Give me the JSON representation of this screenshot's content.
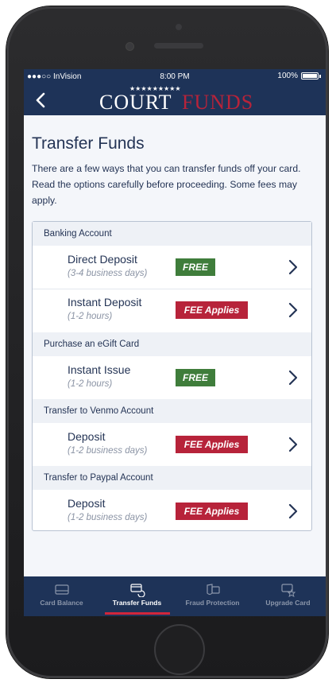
{
  "status_bar": {
    "carrier": "●●●○○ InVision",
    "time": "8:00 PM",
    "battery": "100%"
  },
  "header": {
    "back_icon": "back-chevron-icon",
    "logo_left": "COURT",
    "logo_right": "FUNDS"
  },
  "page": {
    "title": "Transfer Funds",
    "intro": "There are a few ways that you can transfer funds off your card. Read the options carefully before proceeding. Some fees may apply."
  },
  "sections": [
    {
      "header": "Banking Account",
      "options": [
        {
          "name": "Direct Deposit",
          "time": "(3-4 business days)",
          "badge": "FREE",
          "badge_type": "free"
        },
        {
          "name": "Instant Deposit",
          "time": "(1-2 hours)",
          "badge": "FEE Applies",
          "badge_type": "fee"
        }
      ]
    },
    {
      "header": "Purchase an eGift Card",
      "options": [
        {
          "name": "Instant Issue",
          "time": "(1-2 hours)",
          "badge": "FREE",
          "badge_type": "free"
        }
      ]
    },
    {
      "header": "Transfer to Venmo Account",
      "options": [
        {
          "name": "Deposit",
          "time": "(1-2 business days)",
          "badge": "FEE Applies",
          "badge_type": "fee"
        }
      ]
    },
    {
      "header": "Transfer to Paypal Account",
      "options": [
        {
          "name": "Deposit",
          "time": "(1-2 business days)",
          "badge": "FEE Applies",
          "badge_type": "fee"
        }
      ]
    }
  ],
  "tabs": [
    {
      "label": "Card Balance",
      "icon": "card-icon",
      "active": false
    },
    {
      "label": "Transfer Funds",
      "icon": "transfer-card-icon",
      "active": true
    },
    {
      "label": "Fraud Protection",
      "icon": "shield-card-icon",
      "active": false
    },
    {
      "label": "Upgrade Card",
      "icon": "star-card-icon",
      "active": false
    }
  ],
  "colors": {
    "navy": "#1e3358",
    "brand_red": "#b7233a",
    "free_green": "#3f7d3b",
    "active_indicator": "#d0263b"
  }
}
